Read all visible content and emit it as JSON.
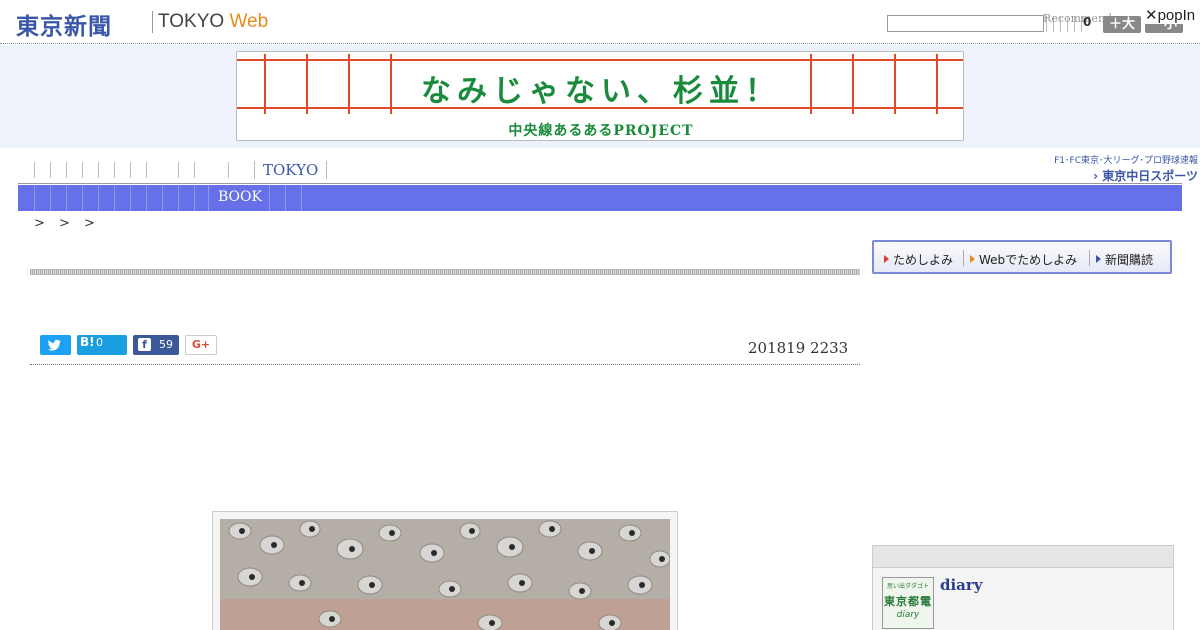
{
  "header": {
    "logo_jp": "東京新聞",
    "logo_tokyo": "TOKYO",
    "logo_web": "Web",
    "recommend": "Recommend",
    "count": "0",
    "size_up": "＋大",
    "size_down": "－小",
    "popin": "popIn"
  },
  "banner": {
    "title": "なみじゃない、杉並！",
    "subtitle": "中央線あるあるPROJECT"
  },
  "top_nav": {
    "tokyo": "TOKYO",
    "chunichi_top": "F1･FC東京･大リーグ･プロ野球速報",
    "chunichi_logo": "東京中日スポーツ"
  },
  "category_bar": {
    "book": "BOOK"
  },
  "breadcrumb": "> > >",
  "article": {
    "date": "201819 2233",
    "share": {
      "hatena_label": "B!",
      "hatena_count": "0",
      "facebook_f": "f",
      "facebook_count": "59",
      "gplus": "G+"
    }
  },
  "sidebar": {
    "promo": [
      "ためしよみ",
      "Webでためしよみ",
      "新聞購読"
    ],
    "diary_link": "diary",
    "diary_thumb": {
      "small": "思い出ダダゴト",
      "big": "東京都電",
      "en": "diary"
    }
  },
  "colors": {
    "brand_blue": "#3a56a8",
    "category_bar": "#6670e8",
    "banner_green": "#1a8a3c",
    "twitter": "#1da1f2",
    "hatena": "#1a9ee0",
    "facebook": "#3b5998"
  },
  "icons": [
    "twitter-icon",
    "facebook-icon",
    "close-icon",
    "arrow-right-icon"
  ]
}
